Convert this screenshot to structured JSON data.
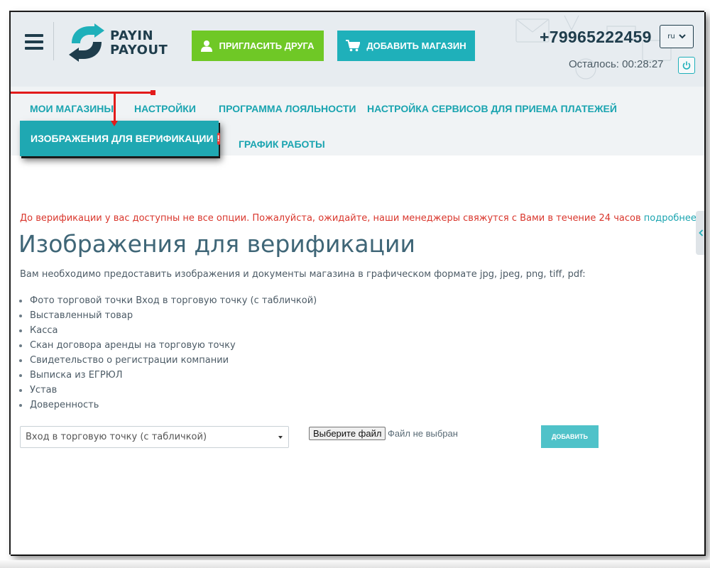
{
  "brand": {
    "line1": "PAYIN",
    "line2": "PAYOUT",
    "color": "#1f3d4c",
    "accent": "#1fb0ba"
  },
  "header": {
    "invite_label": "ПРИГЛАСИТЬ ДРУГА",
    "add_store_label": "ДОБАВИТЬ МАГАЗИН",
    "phone": "+79965222459",
    "remaining": "Осталось: 00:28:27",
    "language": "ru"
  },
  "nav": {
    "items": [
      {
        "label": "МОИ МАГАЗИНЫ"
      },
      {
        "label": "НАСТРОЙКИ"
      },
      {
        "label": "ПРОГРАММА ЛОЯЛЬНОСТИ"
      },
      {
        "label": "НАСТРОЙКА СЕРВИСОВ ДЛЯ ПРИЕМА ПЛАТЕЖЕЙ"
      },
      {
        "label": "ИЗОБРАЖЕНИЯ ДЛЯ ВЕРИФИКАЦИИ",
        "active": true,
        "badge": "!"
      },
      {
        "label": "ГРАФИК РАБОТЫ"
      }
    ]
  },
  "content": {
    "notice": "До верификации у вас доступны не все опции. Пожалуйста, ожидайте, наши менеджеры свяжутся с Вами в течение 24 часов",
    "notice_link": "подробнее",
    "title": "Изображения для верификации",
    "description": "Вам необходимо предоставить изображения и документы магазина в графическом формате jpg, jpeg, png, tiff, pdf:",
    "documents": [
      "Фото торговой точки Вход в торговую точку (с табличкой)",
      "Выставленный товар",
      "Касса",
      "Скан договора аренды на торговую точку",
      "Свидетельство о регистрации компании",
      "Выписка из ЕГРЮЛ",
      "Устав",
      "Доверенность"
    ]
  },
  "upload": {
    "selected_type": "Вход в торговую точку (с табличкой)",
    "file_button": "Выберите файл",
    "file_status": "Файл не выбран",
    "add_label": "ДОБАВИТЬ"
  },
  "colors": {
    "invite_green": "#6fc826",
    "teal": "#1fb0ba",
    "nav_text": "#1aa4b0",
    "notice_red": "#d9362c",
    "annotation_red": "#e21b1b",
    "title": "#3f6677"
  },
  "icons": [
    "menu-icon",
    "user-icon",
    "cart-icon",
    "chevron-down-icon",
    "power-icon",
    "chevron-left-icon",
    "alert-icon"
  ]
}
